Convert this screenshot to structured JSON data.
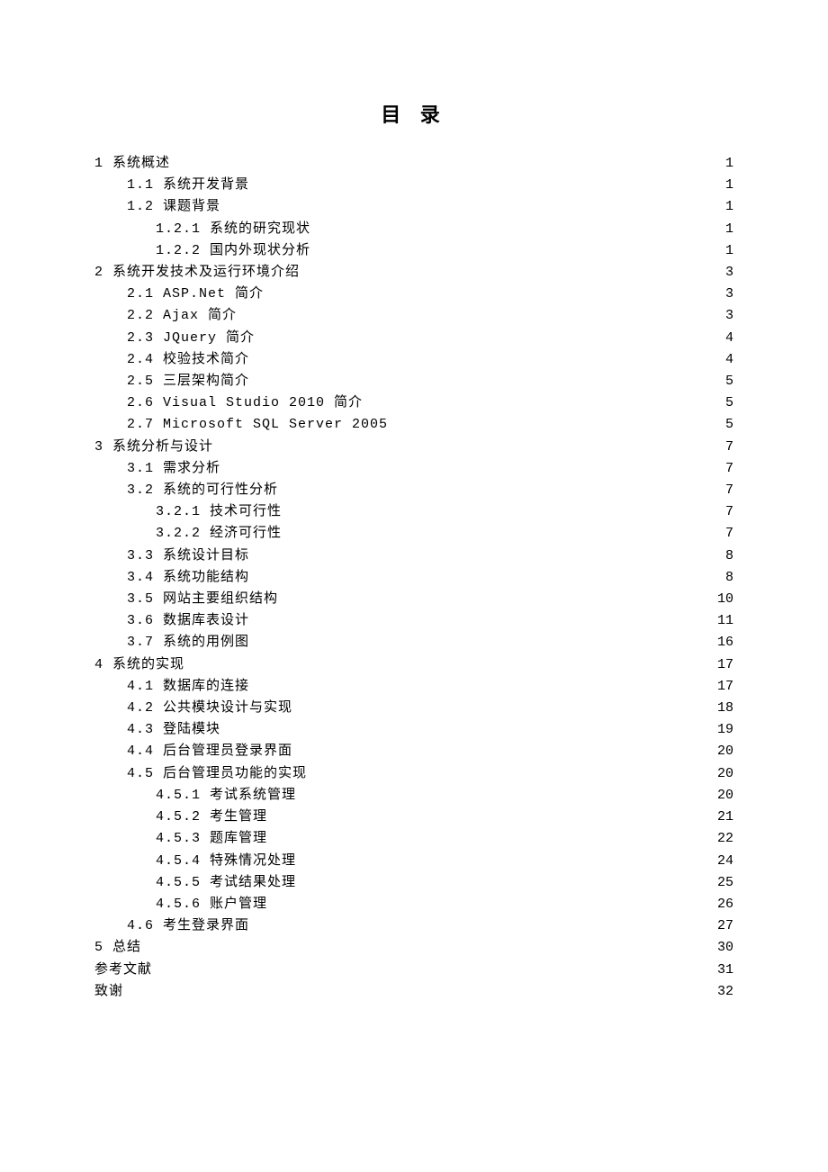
{
  "title": "目 录",
  "toc": [
    {
      "level": 0,
      "label": "1 系统概述 ",
      "page": "1"
    },
    {
      "level": 1,
      "label": "1.1 系统开发背景 ",
      "page": "1"
    },
    {
      "level": 1,
      "label": "1.2 课题背景 ",
      "page": "1"
    },
    {
      "level": 2,
      "label": "1.2.1 系统的研究现状 ",
      "page": "1"
    },
    {
      "level": 2,
      "label": "1.2.2 国内外现状分析 ",
      "page": "1"
    },
    {
      "level": 0,
      "label": "2 系统开发技术及运行环境介绍 ",
      "page": "3"
    },
    {
      "level": 1,
      "label": "2.1 ASP.Net 简介 ",
      "page": "3"
    },
    {
      "level": 1,
      "label": "2.2 Ajax 简介 ",
      "page": "3"
    },
    {
      "level": 1,
      "label": "2.3 JQuery 简介 ",
      "page": "4"
    },
    {
      "level": 1,
      "label": "2.4 校验技术简介 ",
      "page": "4"
    },
    {
      "level": 1,
      "label": "2.5 三层架构简介 ",
      "page": "5"
    },
    {
      "level": 1,
      "label": "2.6 Visual Studio 2010 简介 ",
      "page": "5"
    },
    {
      "level": 1,
      "label": "2.7 Microsoft SQL Server 2005",
      "page": "5"
    },
    {
      "level": 0,
      "label": "3 系统分析与设计 ",
      "page": "7"
    },
    {
      "level": 1,
      "label": "3.1 需求分析 ",
      "page": "7"
    },
    {
      "level": 1,
      "label": "3.2 系统的可行性分析 ",
      "page": "7"
    },
    {
      "level": 2,
      "label": "3.2.1 技术可行性 ",
      "page": "7"
    },
    {
      "level": 2,
      "label": "3.2.2 经济可行性 ",
      "page": "7"
    },
    {
      "level": 1,
      "label": "3.3 系统设计目标 ",
      "page": "8"
    },
    {
      "level": 1,
      "label": "3.4 系统功能结构 ",
      "page": "8"
    },
    {
      "level": 1,
      "label": "3.5 网站主要组织结构",
      "page": "10"
    },
    {
      "level": 1,
      "label": "3.6 数据库表设计 ",
      "page": "11"
    },
    {
      "level": 1,
      "label": "3.7 系统的用例图 ",
      "page": "16"
    },
    {
      "level": 0,
      "label": "4 系统的实现 ",
      "page": "17"
    },
    {
      "level": 1,
      "label": "4.1 数据库的连接 ",
      "page": "17"
    },
    {
      "level": 1,
      "label": "4.2 公共模块设计与实现",
      "page": "18"
    },
    {
      "level": 1,
      "label": "4.3 登陆模块 ",
      "page": "19"
    },
    {
      "level": 1,
      "label": "4.4 后台管理员登录界面 ",
      "page": "20"
    },
    {
      "level": 1,
      "label": "4.5 后台管理员功能的实现",
      "page": "20"
    },
    {
      "level": 2,
      "label": "4.5.1 考试系统管理 ",
      "page": "20"
    },
    {
      "level": 2,
      "label": "4.5.2 考生管理 ",
      "page": "21"
    },
    {
      "level": 2,
      "label": "4.5.3 题库管理 ",
      "page": "22"
    },
    {
      "level": 2,
      "label": "4.5.4 特殊情况处理 ",
      "page": "24"
    },
    {
      "level": 2,
      "label": "4.5.5 考试结果处理 ",
      "page": "25"
    },
    {
      "level": 2,
      "label": "4.5.6 账户管理 ",
      "page": "26"
    },
    {
      "level": 1,
      "label": "4.6 考生登录界面",
      "page": "27"
    },
    {
      "level": 0,
      "label": "5 总结",
      "page": "30"
    },
    {
      "level": 0,
      "label": "参考文献 ",
      "page": "31"
    },
    {
      "level": 0,
      "label": "致谢 ",
      "page": "32"
    }
  ]
}
